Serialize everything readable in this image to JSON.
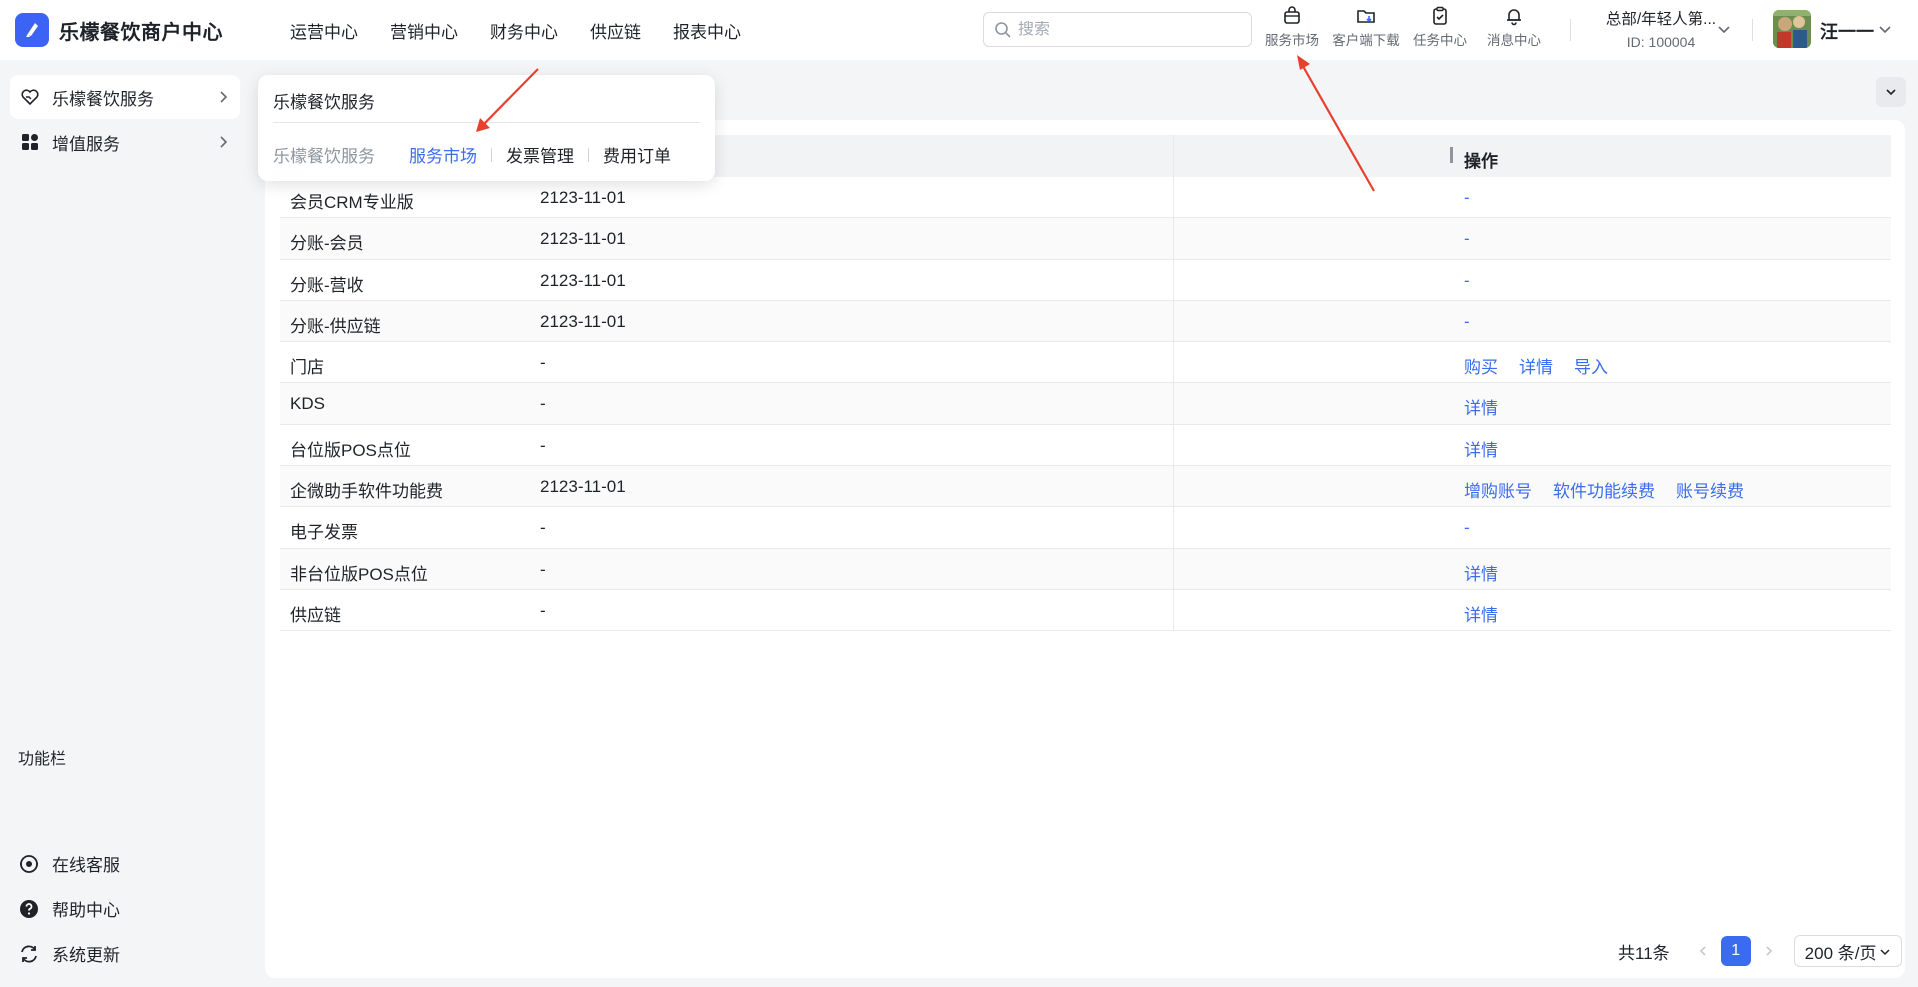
{
  "brand": {
    "name": "乐檬餐饮商户中心",
    "color": "#3d63f5"
  },
  "top_nav": [
    "运营中心",
    "营销中心",
    "财务中心",
    "供应链",
    "报表中心"
  ],
  "search": {
    "placeholder": "搜索",
    "value": ""
  },
  "tools": [
    {
      "label": "服务市场",
      "icon": "shopping-bag-icon"
    },
    {
      "label": "客户端下载",
      "icon": "folder-download-icon"
    },
    {
      "label": "任务中心",
      "icon": "clipboard-check-icon"
    },
    {
      "label": "消息中心",
      "icon": "bell-icon"
    }
  ],
  "org": {
    "name": "总部/年轻人第...",
    "id": "ID: 100004"
  },
  "user": {
    "name": "汪一一"
  },
  "sidebar": {
    "items": [
      {
        "label": "乐檬餐饮服务",
        "icon": "heart-service-icon",
        "active": true
      },
      {
        "label": "增值服务",
        "icon": "apps-grid-icon",
        "active": false
      }
    ],
    "function_title": "功能栏",
    "functions": [
      {
        "label": "在线客服",
        "icon": "headset-icon"
      },
      {
        "label": "帮助中心",
        "icon": "help-circle-icon"
      },
      {
        "label": "系统更新",
        "icon": "refresh-icon"
      }
    ]
  },
  "popover": {
    "title": "乐檬餐饮服务",
    "tabs": [
      {
        "label": "乐檬餐饮服务",
        "state": "muted"
      },
      {
        "label": "服务市场",
        "state": "active"
      },
      {
        "label": "发票管理",
        "state": "normal"
      },
      {
        "label": "费用订单",
        "state": "normal"
      }
    ]
  },
  "table": {
    "operation_header": "操作",
    "rows": [
      {
        "name": "会员CRM专业版",
        "date": "2123-11-01",
        "actions": [],
        "empty": "-"
      },
      {
        "name": "分账-会员",
        "date": "2123-11-01",
        "actions": [],
        "empty": "-"
      },
      {
        "name": "分账-营收",
        "date": "2123-11-01",
        "actions": [],
        "empty": "-"
      },
      {
        "name": "分账-供应链",
        "date": "2123-11-01",
        "actions": [],
        "empty": "-"
      },
      {
        "name": "门店",
        "date": "-",
        "actions": [
          "购买",
          "详情",
          "导入"
        ],
        "empty": ""
      },
      {
        "name": "KDS",
        "date": "-",
        "actions": [
          "详情"
        ],
        "empty": ""
      },
      {
        "name": "台位版POS点位",
        "date": "-",
        "actions": [
          "详情"
        ],
        "empty": ""
      },
      {
        "name": "企微助手软件功能费",
        "date": "2123-11-01",
        "actions": [
          "增购账号",
          "软件功能续费",
          "账号续费"
        ],
        "empty": ""
      },
      {
        "name": "电子发票",
        "date": "-",
        "actions": [],
        "empty": "-"
      },
      {
        "name": "非台位版POS点位",
        "date": "-",
        "actions": [
          "详情"
        ],
        "empty": ""
      },
      {
        "name": "供应链",
        "date": "-",
        "actions": [
          "详情"
        ],
        "empty": ""
      }
    ]
  },
  "pagination": {
    "total": "共11条",
    "current_page": "1",
    "page_size": "200 条/页"
  },
  "colors": {
    "link": "#3b6cf0",
    "annotation_arrow": "#e8402f"
  }
}
